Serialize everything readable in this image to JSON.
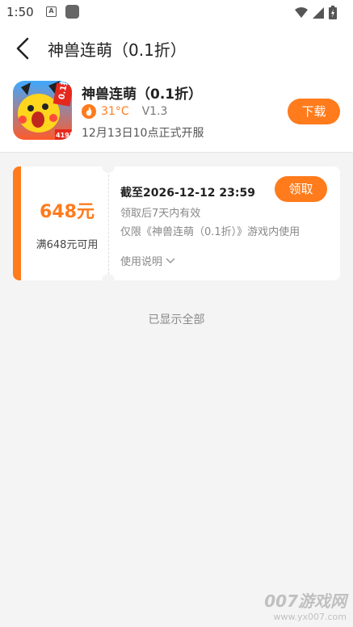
{
  "status_bar": {
    "time": "1:50",
    "icons": [
      "a-notification-icon",
      "app-notification-icon",
      "wifi-icon",
      "signal-icon",
      "battery-icon"
    ]
  },
  "header": {
    "title": "神兽连萌（0.1折）",
    "back_icon": "back-chevron-icon"
  },
  "game": {
    "name": "神兽连萌（0.1折）",
    "temperature": "31°C",
    "version": "V1.3",
    "open_date": "12月13日10点正式开服",
    "download_label": "下载",
    "icon": {
      "badge_text": "0.1折",
      "corner_text": "4197"
    }
  },
  "coupon": {
    "amount": "648元",
    "condition": "满648元可用",
    "deadline": "截至2026-12-12 23:59",
    "validity": "领取后7天内有效",
    "scope": "仅限《神兽连萌（0.1折）》游戏内使用",
    "usage_label": "使用说明",
    "claim_label": "领取"
  },
  "footer": {
    "all_shown": "已显示全部"
  },
  "watermark": {
    "line1": "007游戏网",
    "line2": "www.yx007.com"
  },
  "colors": {
    "accent": "#ff7b1c",
    "background": "#f4f4f4"
  }
}
